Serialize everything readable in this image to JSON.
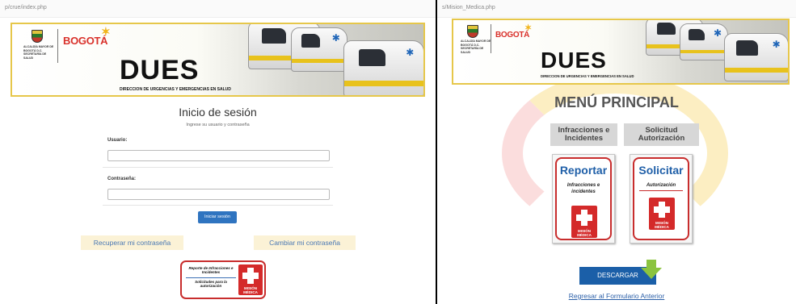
{
  "left": {
    "url": "p/crue/index.php",
    "banner": {
      "alcaldia": "ALCALDÍA MAYOR DE BOGOTÁ D.C. SECRETARÍA DE SALUD",
      "bogota": "BOGOTÁ",
      "dues": "DUES",
      "dues_sub": "DIRECCION DE URGENCIAS Y EMERGENCIAS EN SALUD"
    },
    "login": {
      "title": "Inicio de sesión",
      "subtitle": "Ingrese su usuario y contraseña",
      "user_label": "Usuario:",
      "user_value": "",
      "password_label": "Contraseña:",
      "password_value": "",
      "submit_label": "Iniciar sesión",
      "recover_label": "Recuperar mi contraseña",
      "change_label": "Cambiar mi contraseña"
    },
    "badge": {
      "line1": "Reporte de Infracciones e Incidentes",
      "line2": "Solicitudes para la autorización",
      "cross_text": "MISIÓN MÉDICA"
    }
  },
  "right": {
    "url": "s/Mision_Medica.php",
    "banner": {
      "alcaldia": "ALCALDÍA MAYOR DE BOGOTÁ D.C. SECRETARÍA DE SALUD",
      "bogota": "BOGOTÁ",
      "dues": "DUES",
      "dues_sub": "DIRECCION DE URGENCIAS Y EMERGENCIAS EN SALUD"
    },
    "menu": {
      "title": "MENÚ PRINCIPAL",
      "tabs": [
        "Infracciones e Incidentes",
        "Solicitud Autorización"
      ],
      "tiles": [
        {
          "big": "Reportar",
          "small": "Infracciones e incidentes",
          "cross_text": "MISIÓN MÉDICA"
        },
        {
          "big": "Solicitar",
          "small": "Autorización",
          "cross_text": "MISIÓN MÉDICA"
        }
      ],
      "download_label": "DESCARGAR",
      "back_link": "Regresar al Formulario Anterior"
    }
  },
  "colors": {
    "accent_blue": "#2f74c0",
    "brand_red": "#d42a2a",
    "banner_border": "#e6c74a",
    "download_green": "#8bc43f"
  }
}
